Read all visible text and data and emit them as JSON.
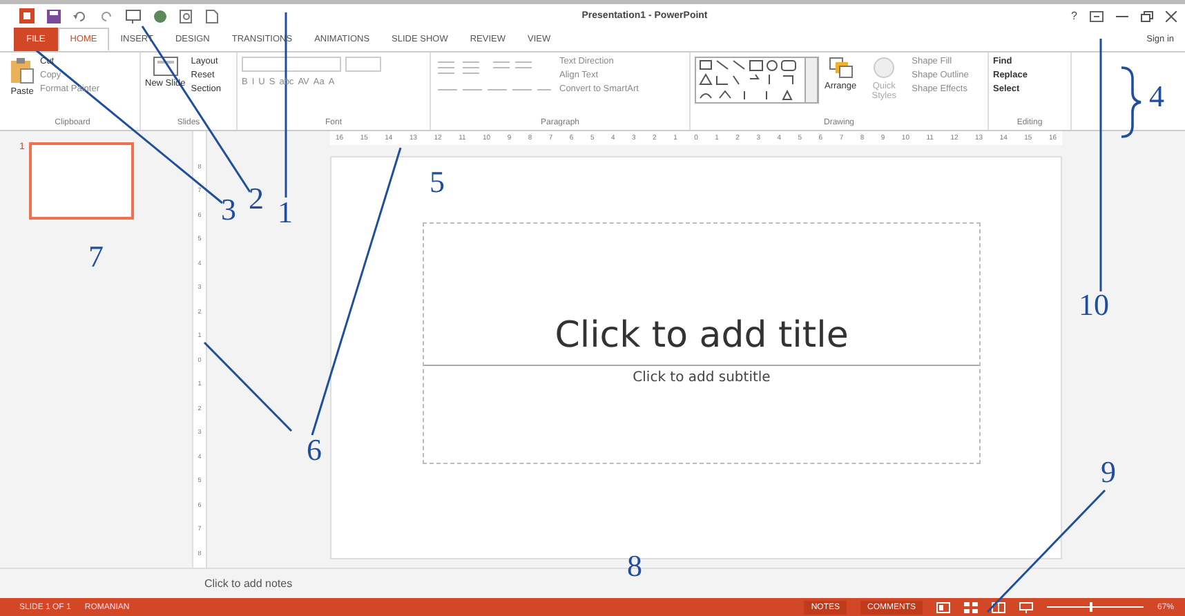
{
  "window": {
    "title": "Presentation1 - PowerPoint",
    "help": "?",
    "sign_in": "Sign in"
  },
  "tabs": [
    {
      "label": "FILE",
      "kind": "file",
      "selected": false
    },
    {
      "label": "HOME",
      "kind": "tab",
      "selected": true
    },
    {
      "label": "INSERT",
      "kind": "tab",
      "selected": false
    },
    {
      "label": "DESIGN",
      "kind": "tab",
      "selected": false
    },
    {
      "label": "TRANSITIONS",
      "kind": "tab",
      "selected": false
    },
    {
      "label": "ANIMATIONS",
      "kind": "tab",
      "selected": false
    },
    {
      "label": "SLIDE SHOW",
      "kind": "tab",
      "selected": false
    },
    {
      "label": "REVIEW",
      "kind": "tab",
      "selected": false
    },
    {
      "label": "VIEW",
      "kind": "tab",
      "selected": false
    }
  ],
  "ribbon": {
    "clipboard": {
      "label": "Clipboard",
      "paste": "Paste",
      "items": [
        {
          "label": "Cut",
          "disabled": false
        },
        {
          "label": "Copy",
          "disabled": true
        },
        {
          "label": "Format Painter",
          "disabled": true
        }
      ]
    },
    "slides": {
      "label": "Slides",
      "new_slide": "New Slide",
      "items": [
        {
          "label": "Layout",
          "disabled": false
        },
        {
          "label": "Reset",
          "disabled": false
        },
        {
          "label": "Section",
          "disabled": false
        }
      ]
    },
    "font": {
      "label": "Font",
      "disabled": true,
      "buttons": [
        "B",
        "I",
        "U",
        "S",
        "abc",
        "AV",
        "Aa",
        "A"
      ]
    },
    "paragraph": {
      "label": "Paragraph",
      "items": [
        {
          "label": "Text Direction",
          "disabled": true
        },
        {
          "label": "Align Text",
          "disabled": true
        },
        {
          "label": "Convert to SmartArt",
          "disabled": true
        }
      ]
    },
    "drawing": {
      "label": "Drawing",
      "arrange": "Arrange",
      "quick_styles": "Quick Styles",
      "items": [
        {
          "label": "Shape Fill",
          "disabled": true
        },
        {
          "label": "Shape Outline",
          "disabled": true
        },
        {
          "label": "Shape Effects",
          "disabled": true
        }
      ]
    },
    "editing": {
      "label": "Editing",
      "items": [
        {
          "label": "Find",
          "disabled": false
        },
        {
          "label": "Replace",
          "disabled": false
        },
        {
          "label": "Select",
          "disabled": false
        }
      ]
    }
  },
  "thumbnails": [
    {
      "number": "1",
      "selected": true
    }
  ],
  "ruler": [
    "16",
    "15",
    "14",
    "13",
    "12",
    "11",
    "10",
    "9",
    "8",
    "7",
    "6",
    "5",
    "4",
    "3",
    "2",
    "1",
    "0",
    "1",
    "2",
    "3",
    "4",
    "5",
    "6",
    "7",
    "8",
    "9",
    "10",
    "11",
    "12",
    "13",
    "14",
    "15",
    "16"
  ],
  "vertical_ruler": [
    "8",
    "7",
    "6",
    "5",
    "4",
    "3",
    "2",
    "1",
    "0",
    "1",
    "2",
    "3",
    "4",
    "5",
    "6",
    "7",
    "8"
  ],
  "slide": {
    "title_placeholder": "Click to add title",
    "subtitle_placeholder": "Click to add subtitle"
  },
  "notes_placeholder": "Click to add notes",
  "status_bar": {
    "slide_info": "SLIDE 1 OF 1",
    "language": "ROMANIAN",
    "notes": "NOTES",
    "comments": "COMMENTS",
    "zoom": "67%",
    "zoom_level": {
      "level": 0.45
    }
  },
  "callouts": [
    {
      "label": "1"
    },
    {
      "label": "2"
    },
    {
      "label": "3"
    },
    {
      "label": "4"
    },
    {
      "label": "5"
    },
    {
      "label": "6"
    },
    {
      "label": "7"
    },
    {
      "label": "8"
    },
    {
      "label": "9"
    },
    {
      "label": "10"
    }
  ]
}
